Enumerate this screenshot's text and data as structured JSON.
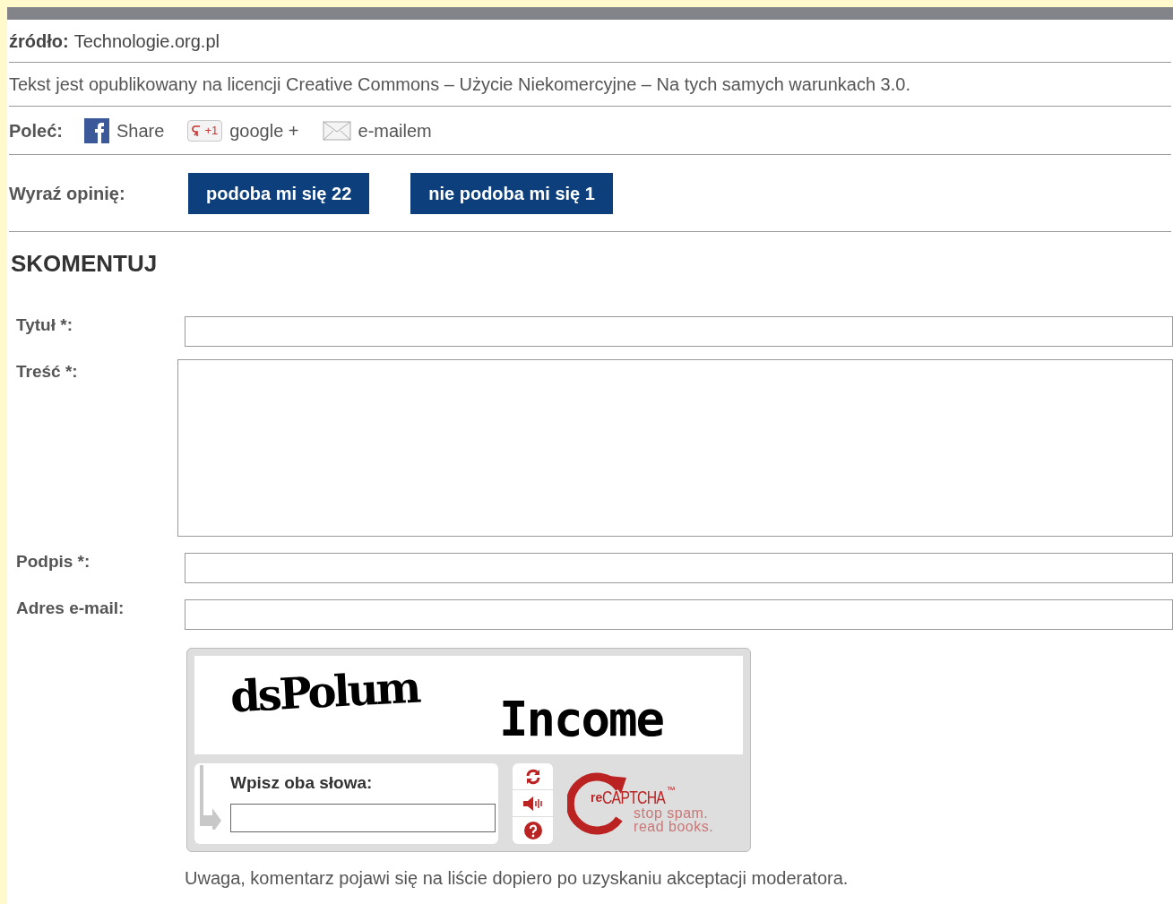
{
  "source": {
    "label": "źródło:",
    "value": "Technologie.org.pl"
  },
  "license": "Tekst jest opublikowany na licencji Creative Commons – Użycie Niekomercyjne – Na tych samych warunkach 3.0.",
  "share": {
    "label": "Poleć:",
    "items": [
      {
        "kind": "facebook",
        "label": "Share"
      },
      {
        "kind": "google",
        "icon_text": "+1",
        "label": "google +"
      },
      {
        "kind": "email",
        "label": "e-mailem"
      }
    ]
  },
  "opinion": {
    "label": "Wyraź opinię:",
    "buttons": [
      "podoba mi się 22",
      "nie podoba mi się 1"
    ]
  },
  "comment_form": {
    "heading": "SKOMENTUJ",
    "fields": [
      {
        "kind": "input",
        "label": "Tytuł *:"
      },
      {
        "kind": "textarea",
        "label": "Treść *:"
      },
      {
        "kind": "input",
        "label": "Podpis *:"
      },
      {
        "kind": "input",
        "label": "Adres e-mail:"
      }
    ],
    "captcha": {
      "words": [
        "dsPolum",
        "Income"
      ],
      "prompt": "Wpisz oba słowa:",
      "logo": {
        "prefix": "re",
        "name": "CAPTCHA",
        "tm": "™",
        "slogan_1": "stop spam.",
        "slogan_2": "read books."
      }
    },
    "note": "Uwaga, komentarz pojawi się na liście dopiero po uzyskaniu akceptacji moderatora."
  }
}
